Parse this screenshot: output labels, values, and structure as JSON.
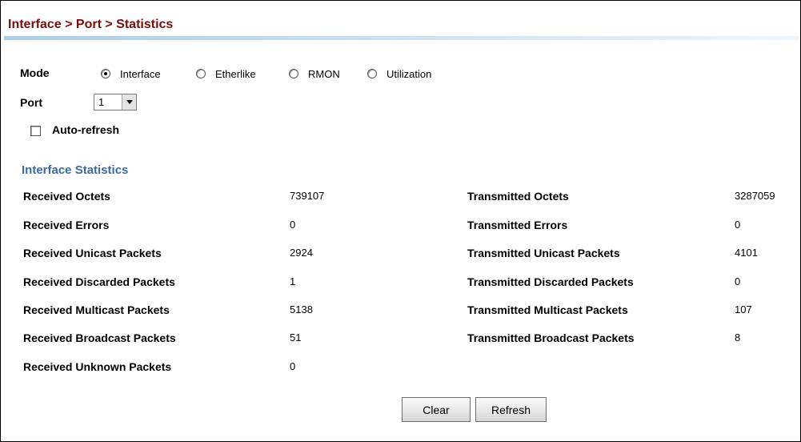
{
  "header": {
    "title": "Interface > Port > Statistics"
  },
  "mode": {
    "label": "Mode",
    "options": [
      {
        "label": "Interface",
        "selected": true
      },
      {
        "label": "Etherlike",
        "selected": false
      },
      {
        "label": "RMON",
        "selected": false
      },
      {
        "label": "Utilization",
        "selected": false
      }
    ]
  },
  "port": {
    "label": "Port",
    "selected_value": "1"
  },
  "auto_refresh": {
    "label": "Auto-refresh",
    "checked": false
  },
  "section": {
    "title": "Interface Statistics"
  },
  "received": [
    {
      "label": "Received Octets",
      "value": "739107"
    },
    {
      "label": "Received Errors",
      "value": "0"
    },
    {
      "label": "Received Unicast Packets",
      "value": "2924"
    },
    {
      "label": "Received Discarded Packets",
      "value": "1"
    },
    {
      "label": "Received Multicast Packets",
      "value": "5138"
    },
    {
      "label": "Received Broadcast Packets",
      "value": "51"
    },
    {
      "label": "Received Unknown Packets",
      "value": "0"
    }
  ],
  "transmitted": [
    {
      "label": "Transmitted Octets",
      "value": "3287059"
    },
    {
      "label": "Transmitted Errors",
      "value": "0"
    },
    {
      "label": "Transmitted Unicast Packets",
      "value": "4101"
    },
    {
      "label": "Transmitted Discarded Packets",
      "value": "0"
    },
    {
      "label": "Transmitted Multicast Packets",
      "value": "107"
    },
    {
      "label": "Transmitted Broadcast Packets",
      "value": "8"
    }
  ],
  "buttons": {
    "clear_label": "Clear",
    "refresh_label": "Refresh"
  },
  "colors": {
    "title": "#7b0c0c",
    "section_title": "#3a6aa5",
    "title_rule": "#a9cde9"
  },
  "icons": {
    "select_arrow": "chevron-down-icon",
    "radio_checked": "radio-checked-icon",
    "radio_unchecked": "radio-unchecked-icon",
    "checkbox": "checkbox-icon"
  }
}
